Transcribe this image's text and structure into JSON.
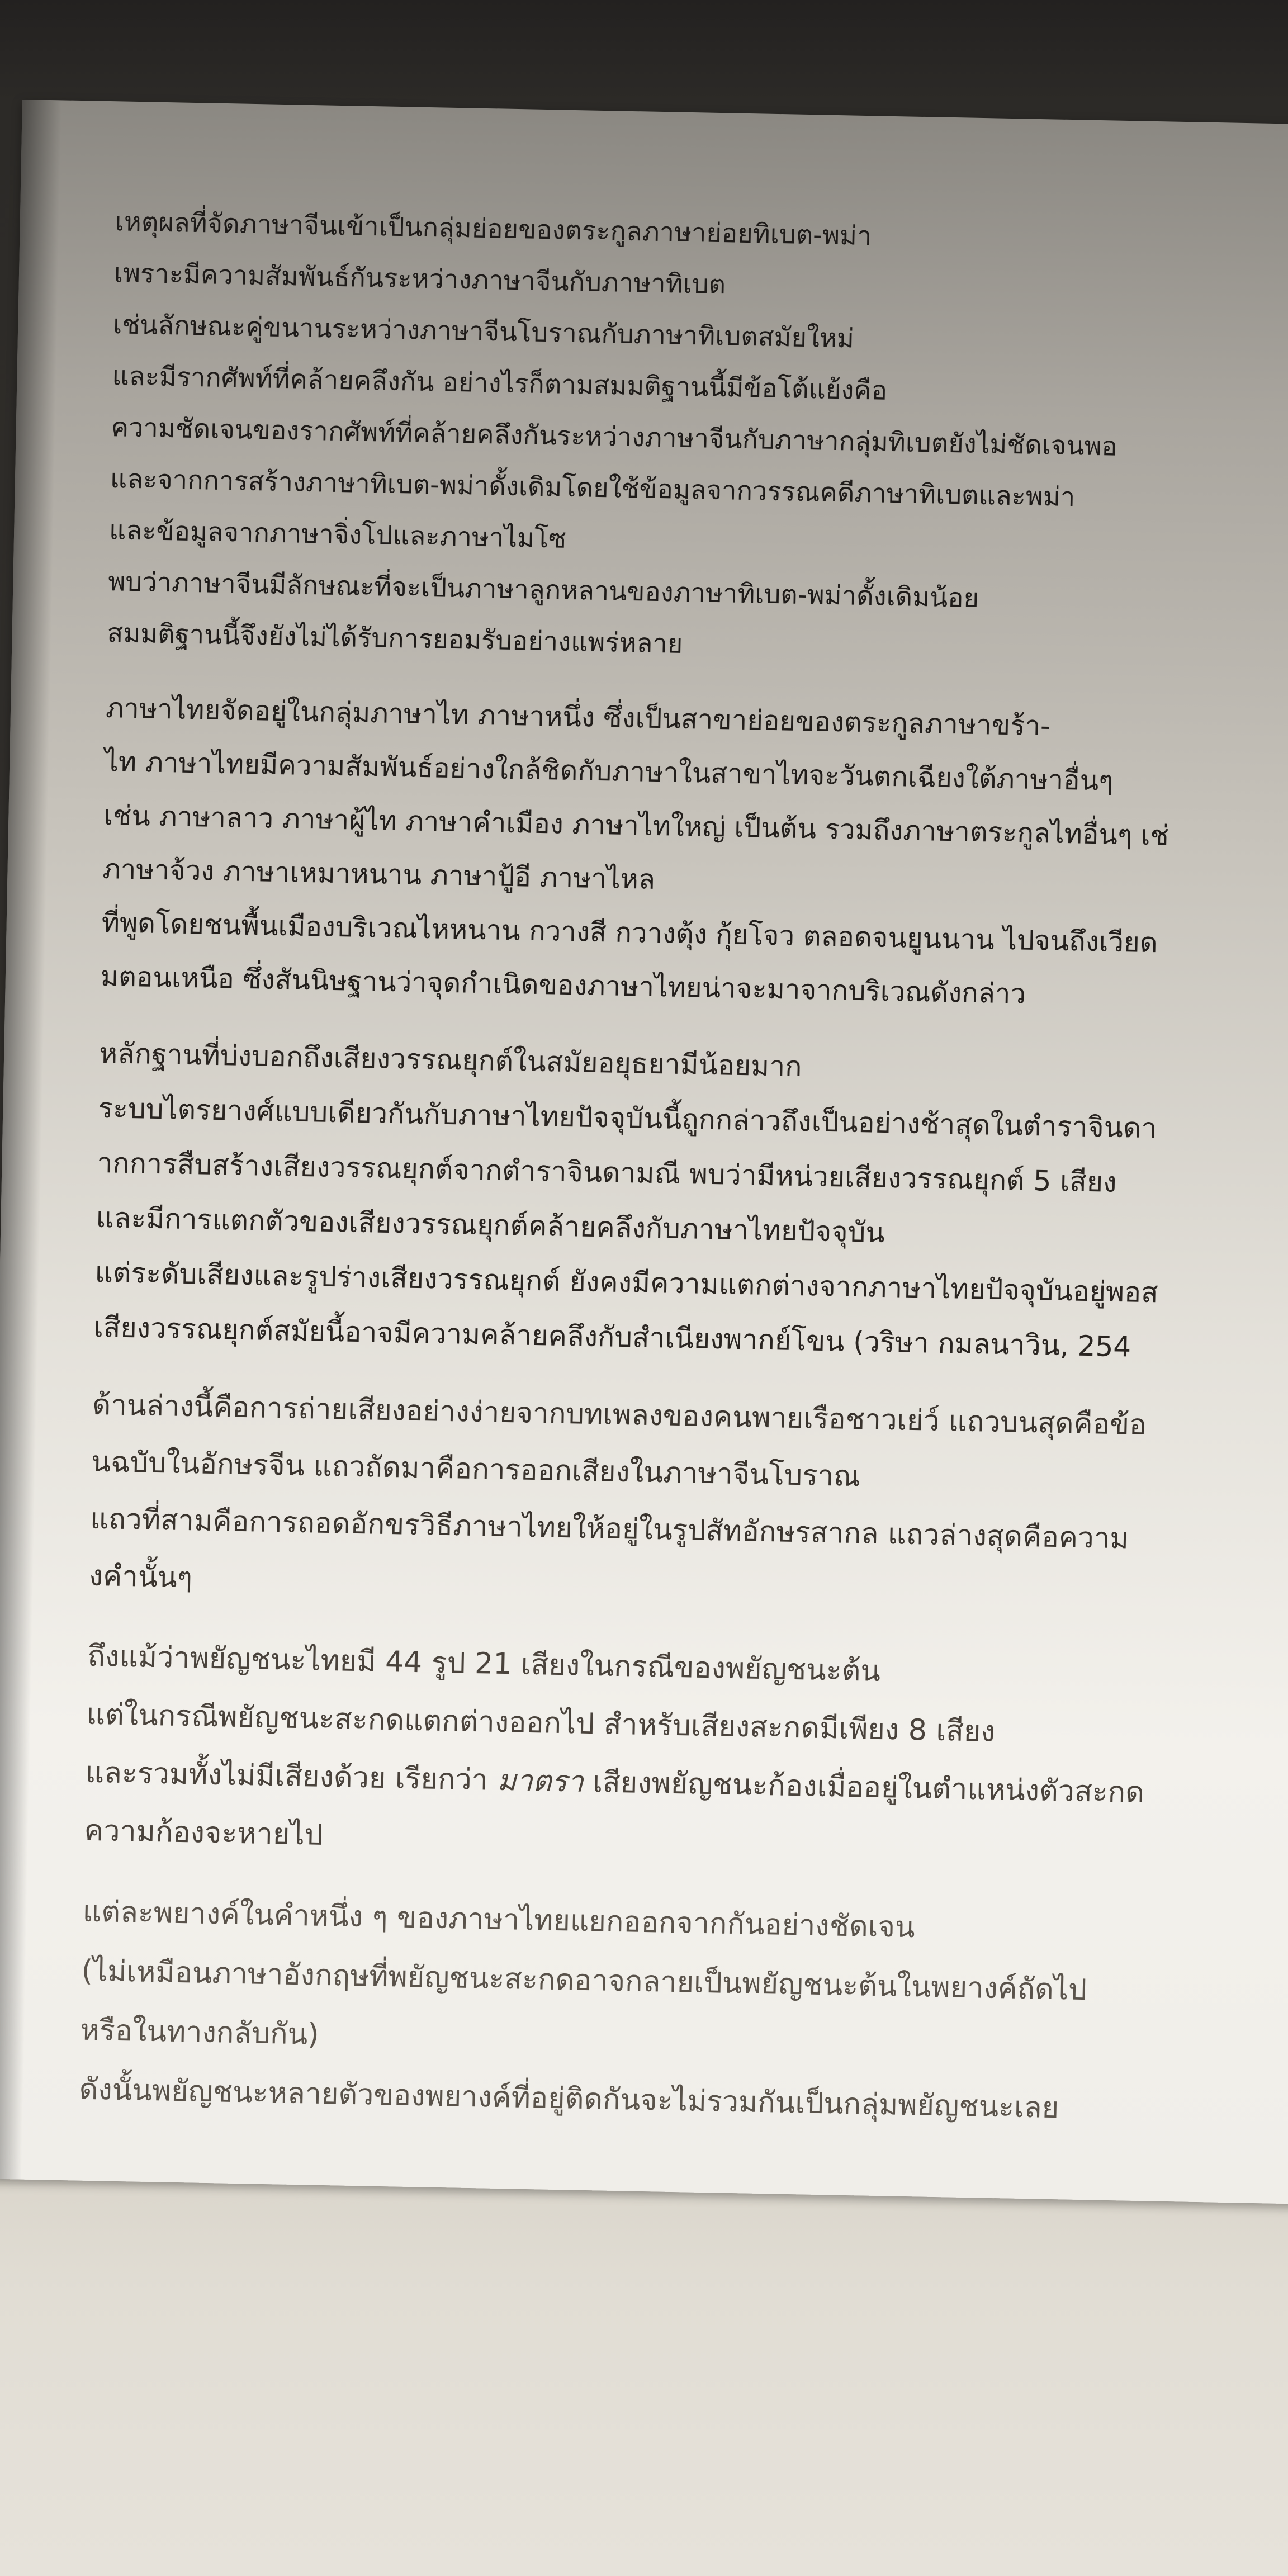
{
  "paragraphs": [
    {
      "lines": [
        "เหตุผลที่จัดภาษาจีนเข้าเป็นกลุ่มย่อยของตระกูลภาษาย่อยทิเบต-พม่า",
        "เพราะมีความสัมพันธ์กันระหว่างภาษาจีนกับภาษาทิเบต",
        "เช่นลักษณะคู่ขนานระหว่างภาษาจีนโบราณกับภาษาทิเบตสมัยใหม่",
        "และมีรากศัพท์ที่คล้ายคลึงกัน อย่างไรก็ตามสมมติฐานนี้มีข้อโต้แย้งคือ",
        "ความชัดเจนของรากศัพท์ที่คล้ายคลึงกันระหว่างภาษาจีนกับภาษากลุ่มทิเบตยังไม่ชัดเจนพอ",
        "และจากการสร้างภาษาทิเบต-พม่าดั้งเดิมโดยใช้ข้อมูลจากวรรณคดีภาษาทิเบตและพม่า",
        "และข้อมูลจากภาษาจิ่งโปและภาษาไมโซ",
        "พบว่าภาษาจีนมีลักษณะที่จะเป็นภาษาลูกหลานของภาษาทิเบต-พม่าดั้งเดิมน้อย",
        "สมมติฐานนี้จึงยังไม่ได้รับการยอมรับอย่างแพร่หลาย"
      ]
    },
    {
      "lines": [
        "ภาษาไทยจัดอยู่ในกลุ่มภาษาไท ภาษาหนึ่ง ซึ่งเป็นสาขาย่อยของตระกูลภาษาขร้า-",
        "ไท ภาษาไทยมีความสัมพันธ์อย่างใกล้ชิดกับภาษาในสาขาไทจะวันตกเฉียงใต้ภาษาอื่นๆ",
        "เช่น ภาษาลาว ภาษาผู้ไท ภาษาคำเมือง ภาษาไทใหญ่ เป็นต้น รวมถึงภาษาตระกูลไทอื่นๆ เช่",
        "ภาษาจ้วง ภาษาเหมาหนาน ภาษาปู้อี ภาษาไหล",
        "ที่พูดโดยชนพื้นเมืองบริเวณไหหนาน กวางสี กวางตุ้ง กุ้ยโจว ตลอดจนยูนนาน ไปจนถึงเวียด",
        "มตอนเหนือ ซึ่งสันนิษฐานว่าจุดกำเนิดของภาษาไทยน่าจะมาจากบริเวณดังกล่าว"
      ]
    },
    {
      "lines": [
        "หลักฐานที่บ่งบอกถึงเสียงวรรณยุกต์ในสมัยอยุธยามีน้อยมาก",
        "ระบบไตรยางศ์แบบเดียวกันกับภาษาไทยปัจจุบันนี้ถูกกล่าวถึงเป็นอย่างช้าสุดในตำราจินดา",
        "ากการสืบสร้างเสียงวรรณยุกต์จากตำราจินดามณี พบว่ามีหน่วยเสียงวรรณยุกต์ 5 เสียง",
        "และมีการแตกตัวของเสียงวรรณยุกต์คล้ายคลึงกับภาษาไทยปัจจุบัน",
        "แต่ระดับเสียงและรูปร่างเสียงวรรณยุกต์ ยังคงมีความแตกต่างจากภาษาไทยปัจจุบันอยู่พอส",
        "เสียงวรรณยุกต์สมัยนี้อาจมีความคล้ายคลึงกับสำเนียงพากย์โขน (วริษา กมลนาวิน, 254"
      ]
    },
    {
      "lines": [
        "ด้านล่างนี้คือการถ่ายเสียงอย่างง่ายจากบทเพลงของคนพายเรือชาวเย่ว์ แถวบนสุดคือข้อ",
        "นฉบับในอักษรจีน แถวถัดมาคือการออกเสียงในภาษาจีนโบราณ",
        "แถวที่สามคือการถอดอักขรวิธีภาษาไทยให้อยู่ในรูปสัทอักษรสากล แถวล่างสุดคือความ",
        "งคำนั้นๆ"
      ]
    },
    {
      "lines": [
        "ถึงแม้ว่าพยัญชนะไทยมี 44 รูป 21 เสียงในกรณีของพยัญชนะต้น",
        "แต่ในกรณีพยัญชนะสะกดแตกต่างออกไป สำหรับเสียงสะกดมีเพียง 8 เสียง",
        "และรวมทั้งไม่มีเสียงด้วย เรียกว่า ",
        "ความก้องจะหายไป"
      ],
      "italic_word": "มาตรา",
      "line3_tail": " เสียงพยัญชนะก้องเมื่ออยู่ในตำแหน่งตัวสะกด"
    },
    {
      "lines": [
        "แต่ละพยางค์ในคำหนึ่ง ๆ ของภาษาไทยแยกออกจากกันอย่างชัดเจน",
        "(ไม่เหมือนภาษาอังกฤษที่พยัญชนะสะกดอาจกลายเป็นพยัญชนะต้นในพยางค์ถัดไป",
        "หรือในทางกลับกัน)",
        "ดังนั้นพยัญชนะหลายตัวของพยางค์ที่อยู่ติดกันจะไม่รวมกันเป็นกลุ่มพยัญชนะเลย"
      ]
    }
  ]
}
